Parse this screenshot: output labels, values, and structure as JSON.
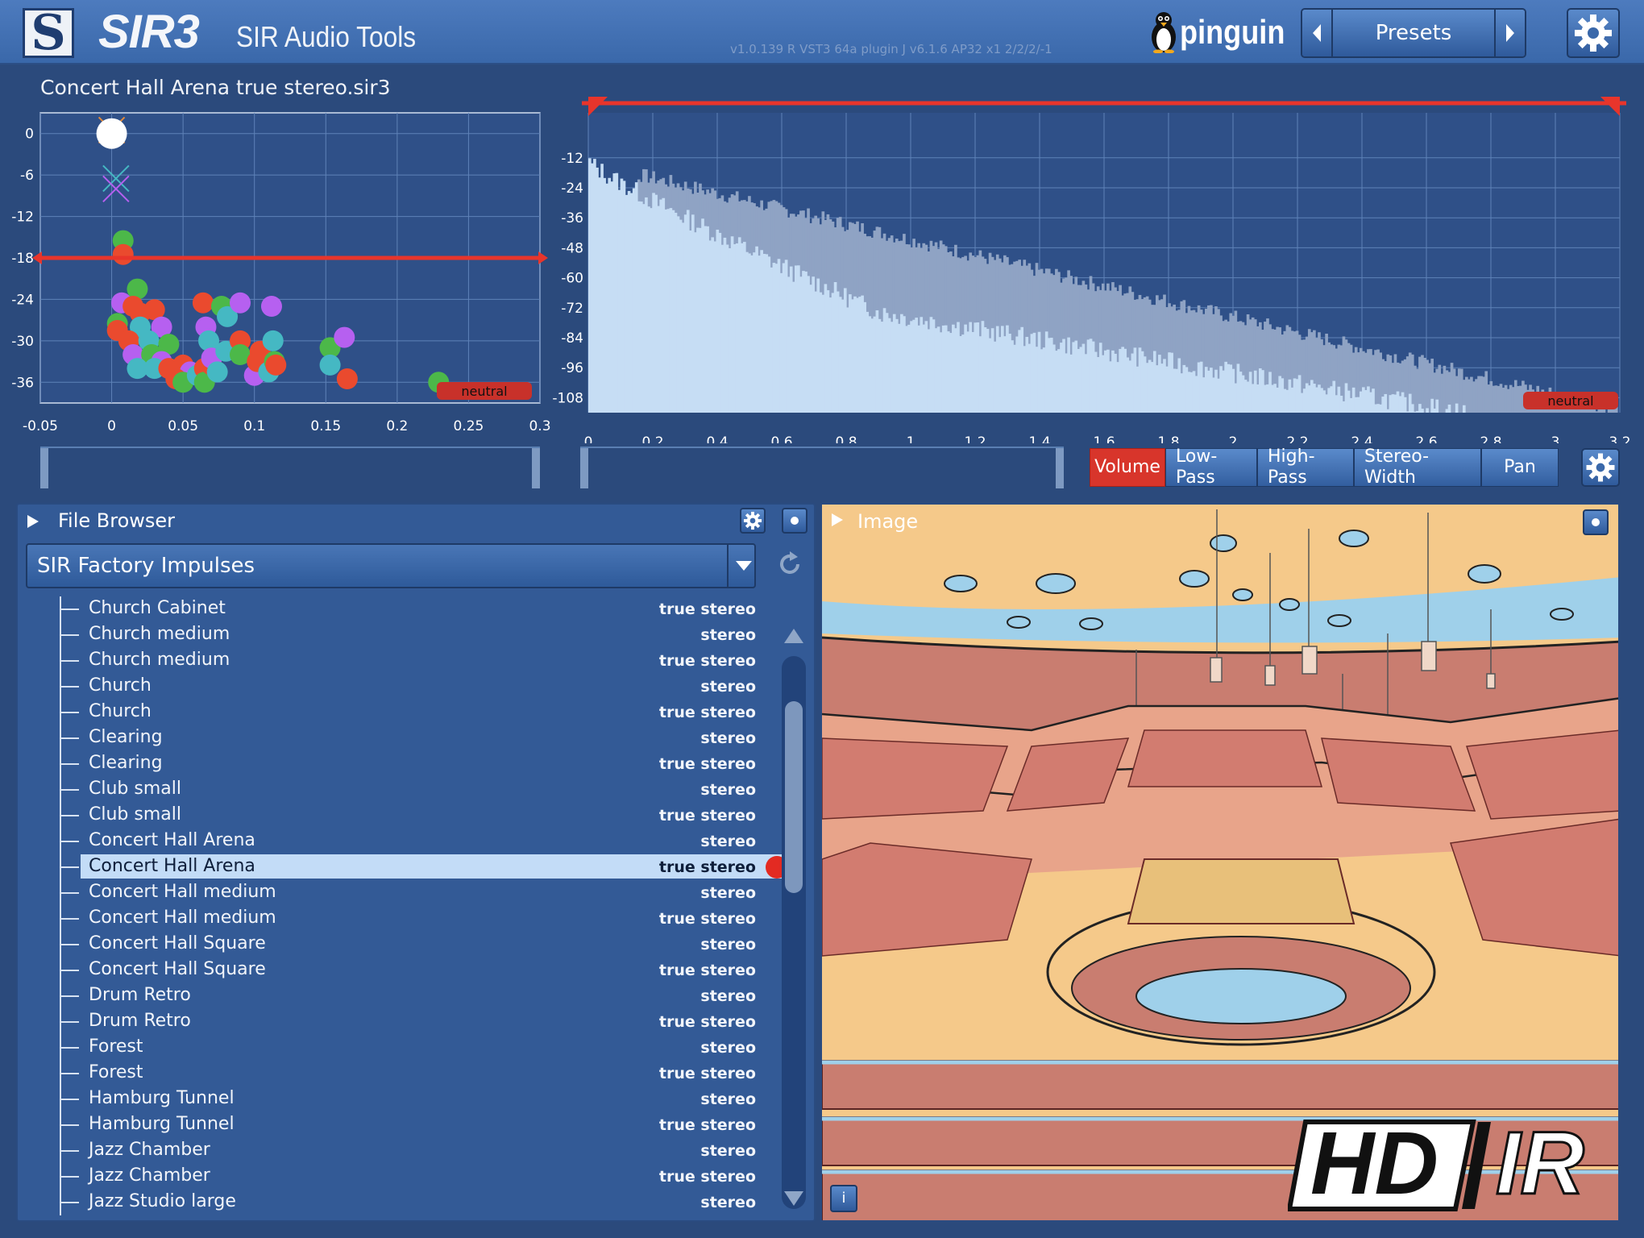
{
  "header": {
    "logo_letter": "S",
    "brand": "SIR3",
    "subtitle": "SIR Audio Tools",
    "version": "v1.0.139 R VST3 64a  plugin J v6.1.6 AP32 x1 2/2/2/-1",
    "pinguin": "pinguin",
    "presets_label": "Presets"
  },
  "file_title": "Concert Hall Arena true stereo.sir3",
  "scatter_chart": {
    "type": "scatter",
    "xlim": [
      -0.05,
      0.3
    ],
    "ylim": [
      -39,
      3
    ],
    "x_ticks": [
      "-0.05",
      "0",
      "0.05",
      "0.1",
      "0.15",
      "0.2",
      "0.25",
      "0.3"
    ],
    "y_ticks": [
      "0",
      "-6",
      "-12",
      "-18",
      "-24",
      "-30",
      "-36"
    ],
    "threshold": -18,
    "neutral_label": "neutral",
    "colors": {
      "green": "#4cb849",
      "red": "#ea4a2e",
      "purple": "#b660f0",
      "teal": "#45b8c3",
      "line": "#e8352b"
    },
    "points": [
      {
        "x": 0.0,
        "y": 0,
        "c": "white"
      },
      {
        "x": 0.008,
        "y": -15.5,
        "c": "green"
      },
      {
        "x": 0.008,
        "y": -17.5,
        "c": "red"
      },
      {
        "x": 0.018,
        "y": -22.5,
        "c": "green"
      },
      {
        "x": 0.007,
        "y": -24.5,
        "c": "purple"
      },
      {
        "x": 0.015,
        "y": -25,
        "c": "red"
      },
      {
        "x": 0.02,
        "y": -26,
        "c": "red"
      },
      {
        "x": 0.03,
        "y": -25.5,
        "c": "red"
      },
      {
        "x": 0.004,
        "y": -27.5,
        "c": "green"
      },
      {
        "x": 0.004,
        "y": -28.5,
        "c": "red"
      },
      {
        "x": 0.02,
        "y": -28,
        "c": "teal"
      },
      {
        "x": 0.035,
        "y": -28,
        "c": "purple"
      },
      {
        "x": 0.012,
        "y": -30,
        "c": "red"
      },
      {
        "x": 0.026,
        "y": -30,
        "c": "teal"
      },
      {
        "x": 0.04,
        "y": -30.5,
        "c": "green"
      },
      {
        "x": 0.015,
        "y": -32,
        "c": "purple"
      },
      {
        "x": 0.028,
        "y": -32,
        "c": "green"
      },
      {
        "x": 0.035,
        "y": -33,
        "c": "purple"
      },
      {
        "x": 0.018,
        "y": -34,
        "c": "teal"
      },
      {
        "x": 0.03,
        "y": -34,
        "c": "teal"
      },
      {
        "x": 0.04,
        "y": -34,
        "c": "red"
      },
      {
        "x": 0.05,
        "y": -33.5,
        "c": "red"
      },
      {
        "x": 0.055,
        "y": -34.5,
        "c": "purple"
      },
      {
        "x": 0.045,
        "y": -35.5,
        "c": "red"
      },
      {
        "x": 0.05,
        "y": -36,
        "c": "green"
      },
      {
        "x": 0.06,
        "y": -35,
        "c": "teal"
      },
      {
        "x": 0.065,
        "y": -34,
        "c": "red"
      },
      {
        "x": 0.065,
        "y": -36,
        "c": "green"
      },
      {
        "x": 0.07,
        "y": -33.5,
        "c": "red"
      },
      {
        "x": 0.064,
        "y": -24.5,
        "c": "red"
      },
      {
        "x": 0.077,
        "y": -25,
        "c": "green"
      },
      {
        "x": 0.081,
        "y": -26.5,
        "c": "teal"
      },
      {
        "x": 0.09,
        "y": -24.5,
        "c": "purple"
      },
      {
        "x": 0.066,
        "y": -28,
        "c": "purple"
      },
      {
        "x": 0.068,
        "y": -30,
        "c": "teal"
      },
      {
        "x": 0.07,
        "y": -32.5,
        "c": "purple"
      },
      {
        "x": 0.074,
        "y": -34.5,
        "c": "teal"
      },
      {
        "x": 0.08,
        "y": -31.5,
        "c": "teal"
      },
      {
        "x": 0.09,
        "y": -30,
        "c": "red"
      },
      {
        "x": 0.09,
        "y": -32,
        "c": "green"
      },
      {
        "x": 0.1,
        "y": -35,
        "c": "purple"
      },
      {
        "x": 0.102,
        "y": -33,
        "c": "red"
      },
      {
        "x": 0.104,
        "y": -31.5,
        "c": "red"
      },
      {
        "x": 0.11,
        "y": -34.5,
        "c": "teal"
      },
      {
        "x": 0.113,
        "y": -30,
        "c": "teal"
      },
      {
        "x": 0.114,
        "y": -33,
        "c": "green"
      },
      {
        "x": 0.115,
        "y": -33.5,
        "c": "red"
      },
      {
        "x": 0.112,
        "y": -25,
        "c": "purple"
      },
      {
        "x": 0.153,
        "y": -31,
        "c": "green"
      },
      {
        "x": 0.153,
        "y": -33.5,
        "c": "teal"
      },
      {
        "x": 0.163,
        "y": -29.5,
        "c": "purple"
      },
      {
        "x": 0.165,
        "y": -35.5,
        "c": "red"
      },
      {
        "x": 0.229,
        "y": -36,
        "c": "green"
      }
    ],
    "markers": [
      {
        "x": 0.003,
        "y": -6.5,
        "c": "#45b8c3"
      },
      {
        "x": 0.003,
        "y": -8,
        "c": "#b660f0"
      },
      {
        "x": 0.0,
        "y": 0.5,
        "c": "#e38a3a"
      }
    ]
  },
  "decay_chart": {
    "type": "bar",
    "xlim": [
      0,
      3.2
    ],
    "ylim": [
      -114,
      6
    ],
    "x_ticks": [
      "0",
      "0.2",
      "0.4",
      "0.6",
      "0.8",
      "1",
      "1.2",
      "1.4",
      "1.6",
      "1.8",
      "2",
      "2.2",
      "2.4",
      "2.6",
      "2.8",
      "3",
      "3.2"
    ],
    "y_ticks": [
      "-12",
      "-24",
      "-36",
      "-48",
      "-60",
      "-72",
      "-84",
      "-96",
      "-108"
    ],
    "neutral_label": "neutral",
    "dark_series_end_db": -113,
    "dark_series_start_db": -14,
    "light_series_end_time": 2.72,
    "light_series_end_db": -114
  },
  "tabs": [
    "Volume",
    "Low-Pass",
    "High-Pass",
    "Stereo-Width",
    "Pan"
  ],
  "browser": {
    "title": "File Browser",
    "folder": "SIR Factory Impulses",
    "items": [
      {
        "name": "Church Cabinet",
        "type": "true stereo"
      },
      {
        "name": "Church medium",
        "type": "stereo"
      },
      {
        "name": "Church medium",
        "type": "true stereo"
      },
      {
        "name": "Church",
        "type": "stereo"
      },
      {
        "name": "Church",
        "type": "true stereo"
      },
      {
        "name": "Clearing",
        "type": "stereo"
      },
      {
        "name": "Clearing",
        "type": "true stereo"
      },
      {
        "name": "Club small",
        "type": "stereo"
      },
      {
        "name": "Club small",
        "type": "true stereo"
      },
      {
        "name": "Concert Hall Arena",
        "type": "stereo"
      },
      {
        "name": "Concert Hall Arena",
        "type": "true stereo",
        "selected": true
      },
      {
        "name": "Concert Hall medium",
        "type": "stereo"
      },
      {
        "name": "Concert Hall medium",
        "type": "true stereo"
      },
      {
        "name": "Concert Hall Square",
        "type": "stereo"
      },
      {
        "name": "Concert Hall Square",
        "type": "true stereo"
      },
      {
        "name": "Drum Retro",
        "type": "stereo"
      },
      {
        "name": "Drum Retro",
        "type": "true stereo"
      },
      {
        "name": "Forest",
        "type": "stereo"
      },
      {
        "name": "Forest",
        "type": "true stereo"
      },
      {
        "name": "Hamburg Tunnel",
        "type": "stereo"
      },
      {
        "name": "Hamburg Tunnel",
        "type": "true stereo"
      },
      {
        "name": "Jazz Chamber",
        "type": "stereo"
      },
      {
        "name": "Jazz Chamber",
        "type": "true stereo"
      },
      {
        "name": "Jazz Studio large",
        "type": "stereo"
      }
    ]
  },
  "image_panel": {
    "title": "Image",
    "badge_left": "HD",
    "badge_right": "IR",
    "info_label": "i"
  }
}
